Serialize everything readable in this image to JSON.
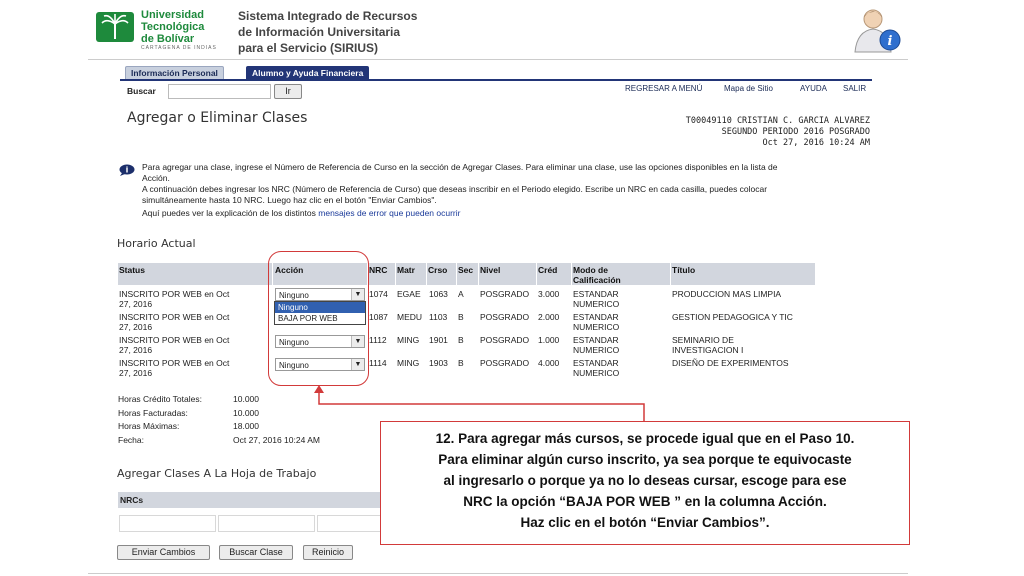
{
  "header": {
    "university": [
      "Universidad",
      "Tecnológica",
      "de Bolívar"
    ],
    "university_sub": "CARTAGENA DE INDIAS",
    "system_title": [
      "Sistema Integrado de Recursos",
      "de Información Universitaria",
      "para el Servicio (SIRIUS)"
    ]
  },
  "tabs": [
    "Información Personal",
    "Alumno y Ayuda Financiera"
  ],
  "search": {
    "label": "Buscar",
    "value": "",
    "button": "Ir"
  },
  "nav": [
    "REGRESAR A MENÚ",
    "Mapa de Sitio",
    "AYUDA",
    "SALIR"
  ],
  "page_title": "Agregar o Eliminar Clases",
  "student": {
    "id_name": "T00049110 CRISTIAN C. GARCIA ALVAREZ",
    "period": "SEGUNDO PERIODO 2016 POSGRADO",
    "datetime": "Oct 27, 2016 10:24 AM"
  },
  "info": {
    "line1": "Para agregar una clase, ingrese el Número de Referencia de Curso en la sección de Agregar Clases. Para eliminar una clase, use las opciones disponibles en la lista de Acción.",
    "line2": "A continuación debes ingresar los NRC (Número de Referencia de Curso) que deseas inscribir en el Periodo elegido. Escribe un NRC en cada casilla, puedes colocar simultáneamente hasta 10 NRC. Luego haz clic en el botón \"Enviar Cambios\".",
    "line3_prefix": "Aquí puedes ver la explicación de los distintos",
    "line3_link": "mensajes de error que pueden ocurrir"
  },
  "schedule": {
    "title": "Horario Actual",
    "headers": {
      "status": "Status",
      "accion": "Acción",
      "nrc": "NRC",
      "matr": "Matr",
      "crso": "Crso",
      "sec": "Sec",
      "nivel": "Nivel",
      "cred": "Créd",
      "modo": [
        "Modo de",
        "Calificación"
      ],
      "titulo": "Título"
    },
    "rows": [
      {
        "status": [
          "INSCRITO POR WEB en Oct",
          "27, 2016"
        ],
        "accion": "Ninguno",
        "nrc": "1074",
        "matr": "EGAE",
        "crso": "1063",
        "sec": "A",
        "nivel": "POSGRADO",
        "cred": "3.000",
        "modo": [
          "ESTANDAR",
          "NUMERICO"
        ],
        "titulo": [
          "PRODUCCION MAS LIMPIA"
        ]
      },
      {
        "status": [
          "INSCRITO POR WEB en Oct",
          "27, 2016"
        ],
        "accion": "Ninguno",
        "nrc": "1087",
        "matr": "MEDU",
        "crso": "1103",
        "sec": "B",
        "nivel": "POSGRADO",
        "cred": "2.000",
        "modo": [
          "ESTANDAR",
          "NUMERICO"
        ],
        "titulo": [
          "GESTION PEDAGOGICA Y TIC"
        ]
      },
      {
        "status": [
          "INSCRITO POR WEB en Oct",
          "27, 2016"
        ],
        "accion": "Ninguno",
        "nrc": "1112",
        "matr": "MING",
        "crso": "1901",
        "sec": "B",
        "nivel": "POSGRADO",
        "cred": "1.000",
        "modo": [
          "ESTANDAR",
          "NUMERICO"
        ],
        "titulo": [
          "SEMINARIO DE",
          "INVESTIGACION I"
        ]
      },
      {
        "status": [
          "INSCRITO POR WEB en Oct",
          "27, 2016"
        ],
        "accion": "Ninguno",
        "nrc": "1114",
        "matr": "MING",
        "crso": "1903",
        "sec": "B",
        "nivel": "POSGRADO",
        "cred": "4.000",
        "modo": [
          "ESTANDAR",
          "NUMERICO"
        ],
        "titulo": [
          "DISEÑO DE EXPERIMENTOS"
        ]
      }
    ],
    "dropdown_options": [
      "Ninguno",
      "BAJA POR WEB"
    ]
  },
  "totals": [
    {
      "label": "Horas Crédito Totales:",
      "value": "10.000"
    },
    {
      "label": "Horas Facturadas:",
      "value": "10.000"
    },
    {
      "label": "Horas Máximas:",
      "value": "18.000"
    },
    {
      "label": "Fecha:",
      "value": "Oct 27, 2016 10:24 AM"
    }
  ],
  "add_section": {
    "title": "Agregar Clases A La Hoja de Trabajo",
    "nrcs_label": "NRCs"
  },
  "buttons": {
    "submit": "Enviar Cambios",
    "search": "Buscar Clase",
    "reset": "Reinicio"
  },
  "callout": [
    "12. Para agregar más cursos, se procede igual que en el Paso 10.",
    "Para eliminar algún curso inscrito, ya sea porque te equivocaste",
    "al ingresarlo o porque ya no lo deseas cursar, escoge para ese",
    "NRC la opción “BAJA POR WEB ” en la columna Acción.",
    "Haz clic en el botón “Enviar Cambios”."
  ],
  "colors": {
    "brand_green": "#1e8a3c",
    "tab_navy": "#223577",
    "callout_red": "#d23a3a",
    "header_gray": "#d2d6de"
  }
}
